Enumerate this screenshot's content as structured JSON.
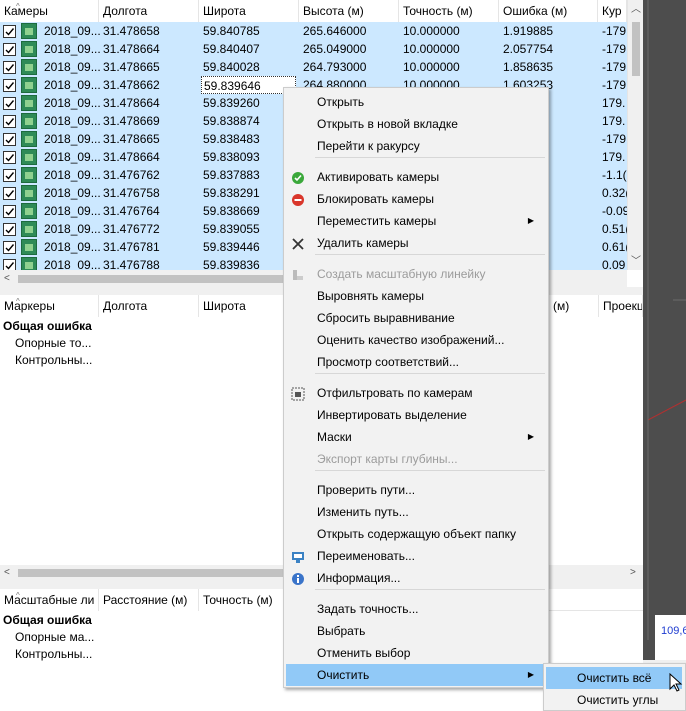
{
  "colors": {
    "selection": "#cce8ff",
    "menu_highlight": "#91c9f7",
    "disabled_text": "#9b9b9b"
  },
  "cameras": {
    "columns": [
      "Камеры",
      "Долгота",
      "Широта",
      "Высота (м)",
      "Точность (м)",
      "Ошибка (м)",
      "Кур"
    ],
    "rows": [
      {
        "name": "2018_09...",
        "lon": "31.478658",
        "lat": "59.840785",
        "alt": "265.646000",
        "acc": "10.000000",
        "err": "1.919885",
        "yaw": "-179"
      },
      {
        "name": "2018_09...",
        "lon": "31.478664",
        "lat": "59.840407",
        "alt": "265.049000",
        "acc": "10.000000",
        "err": "2.057754",
        "yaw": "-179"
      },
      {
        "name": "2018_09...",
        "lon": "31.478665",
        "lat": "59.840028",
        "alt": "264.793000",
        "acc": "10.000000",
        "err": "1.858635",
        "yaw": "-179"
      },
      {
        "name": "2018_09...",
        "lon": "31.478662",
        "lat": "59.839646",
        "alt": "264.880000",
        "acc": "10.000000",
        "err": "1.603253",
        "yaw": "-179"
      },
      {
        "name": "2018_09...",
        "lon": "31.478664",
        "lat": "59.839260",
        "alt": "",
        "acc": "",
        "err": "",
        "yaw": "179."
      },
      {
        "name": "2018_09...",
        "lon": "31.478669",
        "lat": "59.838874",
        "alt": "",
        "acc": "",
        "err": "",
        "yaw": "179."
      },
      {
        "name": "2018_09...",
        "lon": "31.478665",
        "lat": "59.838483",
        "alt": "",
        "acc": "",
        "err": "",
        "yaw": "-179"
      },
      {
        "name": "2018_09...",
        "lon": "31.478664",
        "lat": "59.838093",
        "alt": "",
        "acc": "",
        "err": "",
        "yaw": "179."
      },
      {
        "name": "2018_09...",
        "lon": "31.476762",
        "lat": "59.837883",
        "alt": "",
        "acc": "",
        "err": "",
        "yaw": "-1.1("
      },
      {
        "name": "2018_09...",
        "lon": "31.476758",
        "lat": "59.838291",
        "alt": "",
        "acc": "",
        "err": "",
        "yaw": "0.32("
      },
      {
        "name": "2018_09...",
        "lon": "31.476764",
        "lat": "59.838669",
        "alt": "",
        "acc": "",
        "err": "",
        "yaw": "-0.09"
      },
      {
        "name": "2018_09...",
        "lon": "31.476772",
        "lat": "59.839055",
        "alt": "",
        "acc": "",
        "err": "",
        "yaw": "0.51("
      },
      {
        "name": "2018_09...",
        "lon": "31.476781",
        "lat": "59.839446",
        "alt": "",
        "acc": "",
        "err": "",
        "yaw": "0.61("
      },
      {
        "name": "2018_09...",
        "lon": "31.476788",
        "lat": "59.839836",
        "alt": "",
        "acc": "",
        "err": "",
        "yaw": "0.09"
      }
    ]
  },
  "markers": {
    "columns": [
      "Маркеры",
      "Долгота",
      "Широта",
      "(м)",
      "Проекц"
    ],
    "group": "Общая ошибка",
    "items": [
      "Опорные то...",
      "Контрольны..."
    ]
  },
  "scalebars": {
    "columns": [
      "Масштабные ли",
      "Расстояние (м)",
      "Точность (м)"
    ],
    "group": "Общая ошибка",
    "items": [
      "Опорные ма...",
      "Контрольны..."
    ]
  },
  "viewport": {
    "readout": "109,6"
  },
  "context_menu": {
    "items": [
      {
        "label": "Открыть",
        "icon": ""
      },
      {
        "label": "Открыть в новой вкладке",
        "icon": ""
      },
      {
        "label": "Перейти к ракурсу",
        "icon": ""
      },
      {
        "label": "Активировать камеры",
        "icon": "check-circle-icon"
      },
      {
        "label": "Блокировать камеры",
        "icon": "block-circle-icon"
      },
      {
        "label": "Переместить камеры",
        "icon": "",
        "submenu": true
      },
      {
        "label": "Удалить камеры",
        "icon": "delete-x-icon"
      },
      {
        "label": "Создать масштабную линейку",
        "icon": "scalebar-icon",
        "disabled": true
      },
      {
        "label": "Выровнять камеры",
        "icon": ""
      },
      {
        "label": "Сбросить выравнивание",
        "icon": ""
      },
      {
        "label": "Оценить качество изображений...",
        "icon": ""
      },
      {
        "label": "Просмотр соответствий...",
        "icon": ""
      },
      {
        "label": "Отфильтровать по камерам",
        "icon": "filter-cameras-icon"
      },
      {
        "label": "Инвертировать выделение",
        "icon": ""
      },
      {
        "label": "Маски",
        "icon": "",
        "submenu": true
      },
      {
        "label": "Экспорт карты глубины...",
        "icon": "",
        "disabled": true
      },
      {
        "label": "Проверить пути...",
        "icon": ""
      },
      {
        "label": "Изменить путь...",
        "icon": ""
      },
      {
        "label": "Открыть содержащую объект папку",
        "icon": ""
      },
      {
        "label": "Переименовать...",
        "icon": "rename-icon"
      },
      {
        "label": "Информация...",
        "icon": "info-icon"
      },
      {
        "label": "Задать точность...",
        "icon": ""
      },
      {
        "label": "Выбрать",
        "icon": ""
      },
      {
        "label": "Отменить выбор",
        "icon": ""
      },
      {
        "label": "Очистить",
        "icon": "",
        "submenu": true,
        "highlighted": true
      }
    ]
  },
  "submenu": {
    "items": [
      {
        "label": "Очистить всё",
        "highlighted": true
      },
      {
        "label": "Очистить углы"
      }
    ]
  }
}
